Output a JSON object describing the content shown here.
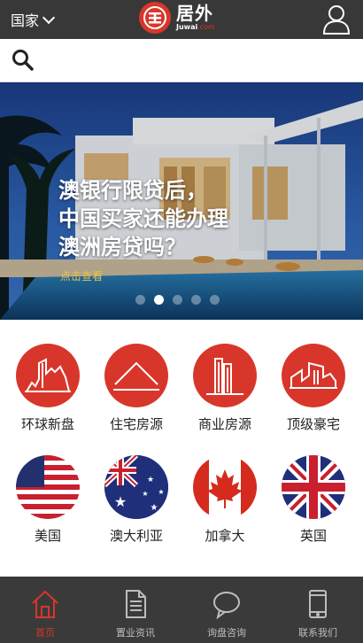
{
  "header": {
    "country_label": "国家",
    "logo_text": "居外",
    "logo_en": "Juwai",
    "logo_en_domain": ".com"
  },
  "search": {
    "placeholder": ""
  },
  "hero": {
    "title_line1": "澳银行限贷后，",
    "title_line2": "中国买家还能办理",
    "title_line3": "澳洲房贷吗？",
    "link_text": "点击查看",
    "active_slide": 2,
    "slide_count": 5
  },
  "categories": [
    {
      "label": "环球新盘",
      "icon": "global-buildings-icon"
    },
    {
      "label": "住宅房源",
      "icon": "house-roof-icon"
    },
    {
      "label": "商业房源",
      "icon": "commercial-tower-icon"
    },
    {
      "label": "顶级豪宅",
      "icon": "luxury-mansion-icon"
    },
    {
      "label": "美国",
      "icon": "us-flag-icon"
    },
    {
      "label": "澳大利亚",
      "icon": "australia-flag-icon"
    },
    {
      "label": "加拿大",
      "icon": "canada-flag-icon"
    },
    {
      "label": "英国",
      "icon": "uk-flag-icon"
    }
  ],
  "bottom_nav": [
    {
      "label": "首页",
      "icon": "home-icon",
      "active": true
    },
    {
      "label": "置业资讯",
      "icon": "document-icon",
      "active": false
    },
    {
      "label": "询盘咨询",
      "icon": "chat-bubble-icon",
      "active": false
    },
    {
      "label": "联系我们",
      "icon": "phone-icon",
      "active": false
    }
  ],
  "colors": {
    "brand_red": "#d9362b",
    "topbar": "#383838",
    "bottom_nav": "#3a3a3a",
    "link_gold": "#e8c24a"
  }
}
